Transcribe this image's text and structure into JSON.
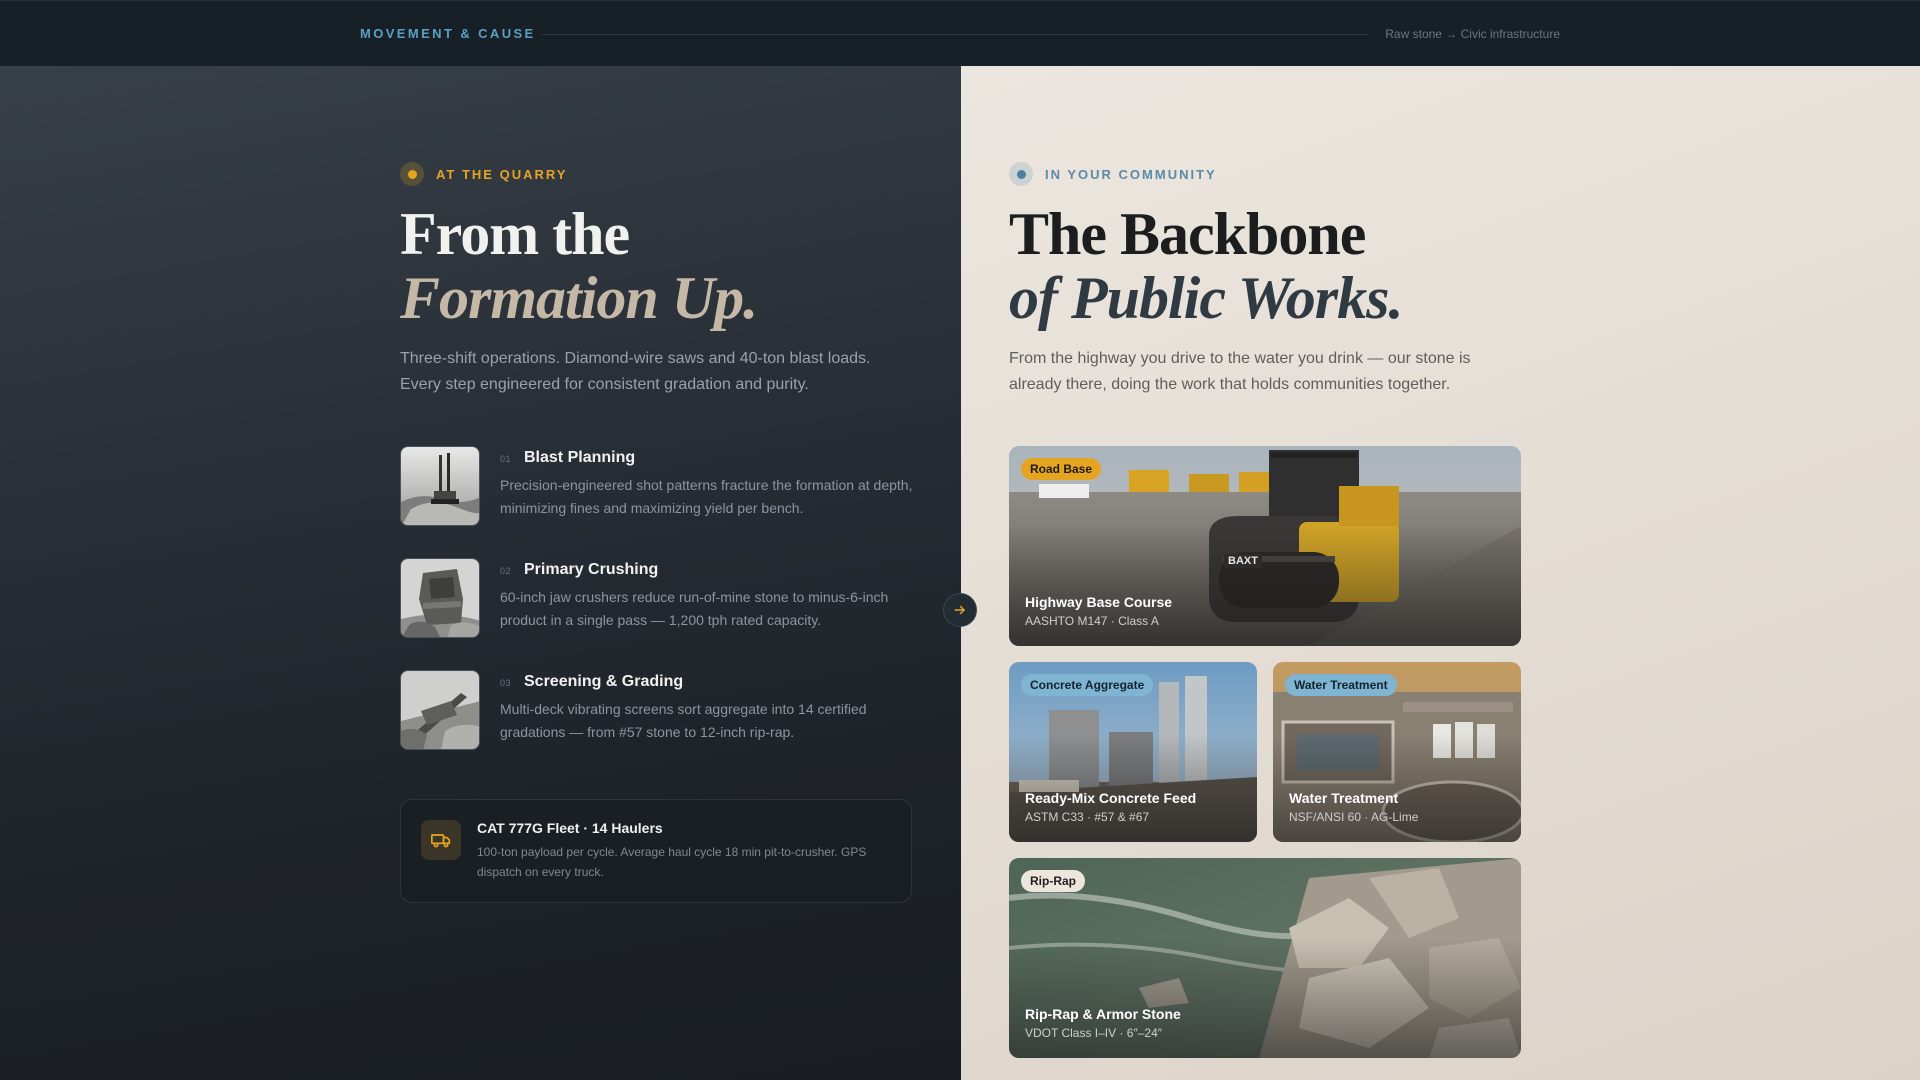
{
  "header": {
    "brand": "MOVEMENT & CAUSE",
    "tagline": "Raw stone → Civic infrastructure"
  },
  "quarry": {
    "eyebrow": "AT THE QUARRY",
    "headline_line1": "From the",
    "headline_line2": "Formation Up.",
    "lede": "Three-shift operations. Diamond-wire saws and 40-ton blast loads. Every step engineered for consistent gradation and purity.",
    "steps": [
      {
        "num": "01",
        "title": "Blast Planning",
        "desc": "Precision-engineered shot patterns fracture the formation at depth, minimizing fines and maximizing yield per bench."
      },
      {
        "num": "02",
        "title": "Primary Crushing",
        "desc": "60-inch jaw crushers reduce run-of-mine stone to minus-6-inch product in a single pass — 1,200 tph rated capacity."
      },
      {
        "num": "03",
        "title": "Screening & Grading",
        "desc": "Multi-deck vibrating screens sort aggregate into 14 certified gradations — from #57 stone to 12-inch rip-rap."
      }
    ],
    "fleet": {
      "title": "CAT 777G Fleet · 14 Haulers",
      "desc": "100-ton payload per cycle. Average haul cycle 18 min pit-to-crusher. GPS dispatch on every truck.",
      "icon": "truck-icon"
    }
  },
  "community": {
    "eyebrow": "IN YOUR COMMUNITY",
    "headline_line1": "The Backbone",
    "headline_line2": "of Public Works.",
    "lede": "From the highway you drive to the water you drink — our stone is already there, doing the work that holds communities together.",
    "cards": [
      {
        "badge": "Road Base",
        "title": "Highway Base Course",
        "sub": "AASHTO M147 · Class A",
        "roller_brand": "BAXT"
      },
      {
        "badge": "Concrete Aggregate",
        "title": "Ready-Mix Concrete Feed",
        "sub": "ASTM C33 · #57 & #67"
      },
      {
        "badge": "Water Treatment",
        "title": "Water Treatment",
        "sub": "NSF/ANSI 60 · AG-Lime"
      },
      {
        "badge": "Rip-Rap",
        "title": "Rip-Rap & Armor Stone",
        "sub": "VDOT Class I–IV · 6″–24″"
      }
    ]
  },
  "colors": {
    "accent_amber": "#e5a521",
    "accent_blue": "#5b9fc2",
    "badge_blue": "#7fb5d3"
  }
}
